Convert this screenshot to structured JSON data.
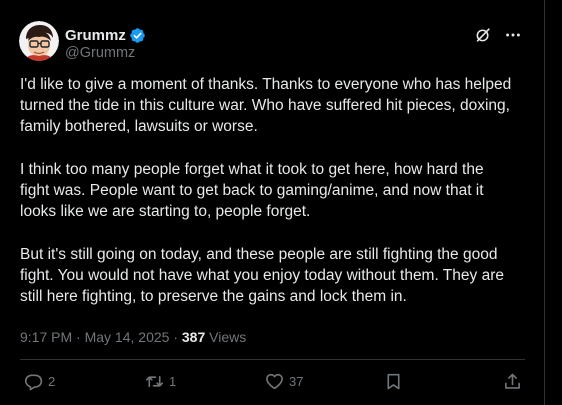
{
  "author": {
    "display_name": "Grummz",
    "handle": "@Grummz",
    "verified_color": "#1d9bf0"
  },
  "post": {
    "paragraphs": [
      [
        "I'd like to give a moment of thanks. Thanks to everyone who has helped",
        "turned the tide in this culture war. Who have suffered hit pieces, doxing,",
        "family bothered, lawsuits or worse."
      ],
      [
        "I think too many people forget what it took to get here, how hard the",
        "fight was. People want to get back to gaming/anime, and now that it",
        "looks like we are starting to, people forget."
      ],
      [
        "But it's still going on today, and these people are still fighting the good",
        "fight. You would not have what you enjoy today without them. They are",
        "still here fighting, to preserve the gains and lock them in."
      ]
    ],
    "time": "9:17 PM",
    "separator": "·",
    "date": "May 14, 2025",
    "views_count": "387",
    "views_label": "Views"
  },
  "actions": {
    "replies": "2",
    "reposts": "1",
    "likes": "37",
    "bookmarks": "",
    "share": ""
  },
  "icons": {
    "grok": "grok-icon",
    "more": "more-icon",
    "reply": "reply-icon",
    "repost": "repost-icon",
    "like": "heart-icon",
    "bookmark": "bookmark-icon",
    "share": "share-icon"
  },
  "colors": {
    "background": "#000000",
    "text": "#e7e9ea",
    "muted": "#71767b",
    "border": "#2f3336",
    "accent": "#1d9bf0"
  }
}
